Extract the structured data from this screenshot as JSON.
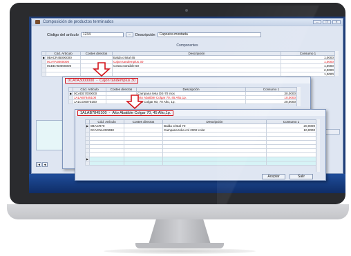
{
  "main_window": {
    "title": "Composición de productos terminados",
    "window_buttons": [
      "—",
      "❐",
      "✕"
    ],
    "codigo_label": "Código del artículo",
    "codigo_value": "1234",
    "lookup_button": "...",
    "descripcion_label": "Descripción",
    "descripcion_value": "Capoeira montada",
    "section_title": "Componentes",
    "columns": [
      "Cód. Artículo",
      "Costes directos",
      "Descripción",
      "Consumo 1"
    ],
    "rows": [
      {
        "codigo": "0BACR45000000",
        "costes": "",
        "descripcion": "Balda cristal 45",
        "consumo": "1,0000",
        "highlight": false
      },
      {
        "codigo": "0CATA3000000",
        "costes": "",
        "descripcion": "Cajon tandemplus 30",
        "consumo": "1,0000",
        "highlight": true
      },
      {
        "codigo": "0CEE>50000000",
        "costes": "",
        "descripcion": "Cesta extraible 50",
        "consumo": "1,0000",
        "highlight": false
      },
      {
        "codigo": "",
        "costes": "",
        "descripcion": "",
        "consumo": "2,0000",
        "highlight": false
      },
      {
        "codigo": "",
        "costes": "",
        "descripcion": "",
        "consumo": "1,0000",
        "highlight": false
      }
    ],
    "nav_first": "|◄",
    "nav_prev": "◄"
  },
  "sub_window_1": {
    "header_code": "0CATA3000000",
    "header_desc": "Cajon tandemplus 30",
    "columns": [
      "Cód. Artículo",
      "Costes directos",
      "Descripción",
      "Consumo 1"
    ],
    "rows": [
      {
        "codigo": "0CADE7000000",
        "costes": "",
        "descripcion": "Campana teka DE-70 inox",
        "consumo": "30,0000",
        "highlight": false
      },
      {
        "codigo": "1ALAB7845100",
        "costes": "",
        "descripcion": "Alto Abatible Colgar 70, 45 Alto,1p.",
        "consumo": "10,0000",
        "highlight": true
      },
      {
        "codigo": "1ALCO6070100",
        "costes": "",
        "descripcion": "Alto Colgar 60, 70 Alto, 1p.",
        "consumo": "20,0000",
        "highlight": false
      }
    ]
  },
  "sub_window_2": {
    "header_code": "1ALAB7845100",
    "header_desc": "Alto Abatible Colgar 70, 45 Alto,1p.",
    "columns": [
      "Cód. Artículo",
      "Costes directos",
      "Descripción",
      "Consumo 1"
    ],
    "rows": [
      {
        "codigo": "0BACR70",
        "costes": "",
        "descripcion": "Balda cristal 70",
        "consumo": "20,0000",
        "highlight": false
      },
      {
        "codigo": "0CACNL2002B0",
        "costes": "",
        "descripcion": "Campana teka cnl 2002 color",
        "consumo": "10,0000",
        "highlight": false
      }
    ],
    "aceptar_label": "Aceptar",
    "salir_label": "Salir"
  },
  "colors": {
    "highlight_red": "#d3141b",
    "row_band": "#d6f3f6",
    "window_bg": "#dfe6f2",
    "desktop_bg": "#1f3e78"
  }
}
